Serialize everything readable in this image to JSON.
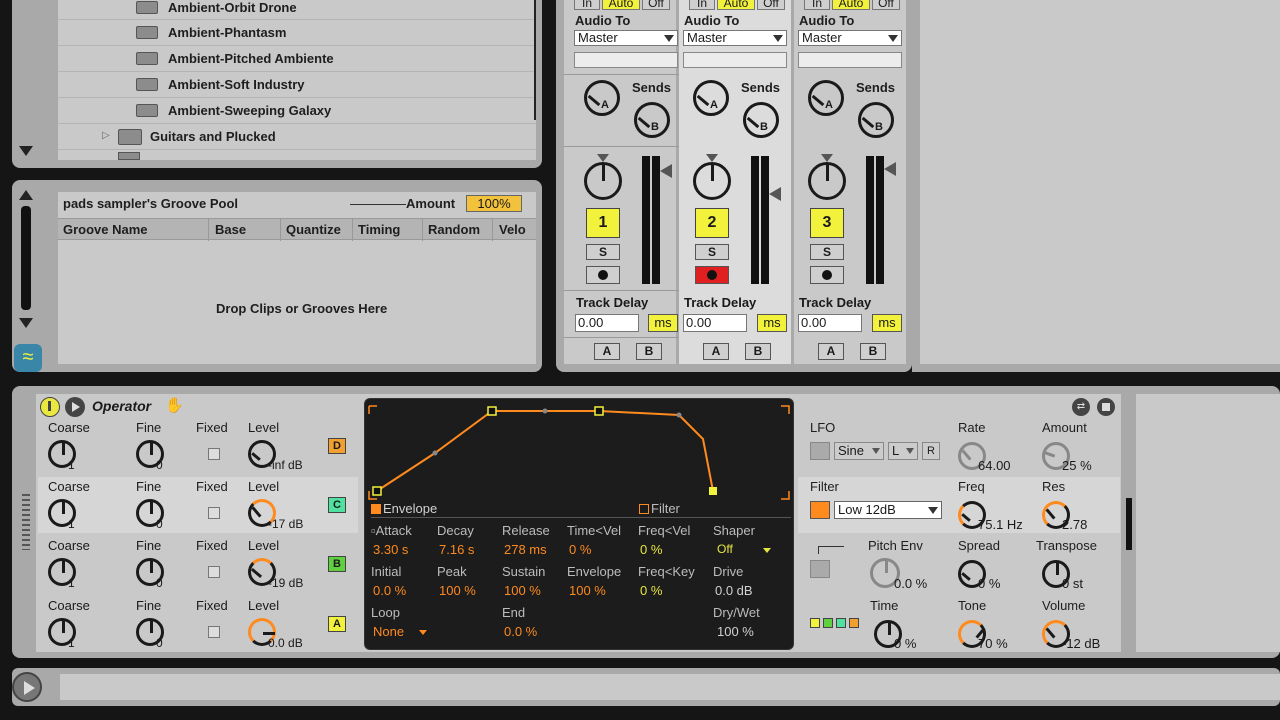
{
  "browser": {
    "items": [
      {
        "label": "Ambient-Orbit Drone"
      },
      {
        "label": "Ambient-Phantasm"
      },
      {
        "label": "Ambient-Pitched Ambiente"
      },
      {
        "label": "Ambient-Soft Industry"
      },
      {
        "label": "Ambient-Sweeping Galaxy"
      }
    ],
    "folder": "Guitars and Plucked"
  },
  "groove_pool": {
    "title": "pads sampler's Groove Pool",
    "amount_label": "Amount",
    "amount_value": "100%",
    "columns": [
      "Groove Name",
      "Base",
      "Quantize",
      "Timing",
      "Random",
      "Velo"
    ],
    "drop_text": "Drop Clips or Grooves Here"
  },
  "mixer": {
    "in_label": "In",
    "auto_label": "Auto",
    "off_label": "Off",
    "audio_to_label": "Audio To",
    "sends_label": "Sends",
    "send_a": "A",
    "send_b": "B",
    "solo_label": "S",
    "track_delay_label": "Track Delay",
    "ms_label": "ms",
    "xfade_a": "A",
    "xfade_b": "B",
    "tracks": [
      {
        "number": "1",
        "output": "Master",
        "delay": "0.00",
        "armed": false
      },
      {
        "number": "2",
        "output": "Master",
        "delay": "0.00",
        "armed": true
      },
      {
        "number": "3",
        "output": "Master",
        "delay": "0.00",
        "armed": false
      }
    ]
  },
  "operator": {
    "title": "Operator",
    "osc_labels": {
      "coarse": "Coarse",
      "fine": "Fine",
      "fixed": "Fixed",
      "level": "Level"
    },
    "oscillators": [
      {
        "coarse": "1",
        "fine": "0",
        "level": "-inf dB",
        "letter": "D",
        "color": "#f0a030"
      },
      {
        "coarse": "1",
        "fine": "0",
        "level": "-17 dB",
        "letter": "C",
        "color": "#50e0a0"
      },
      {
        "coarse": "1",
        "fine": "0",
        "level": "-19 dB",
        "letter": "B",
        "color": "#60d040"
      },
      {
        "coarse": "1",
        "fine": "0",
        "level": "0.0 dB",
        "letter": "A",
        "color": "#f2f23c"
      }
    ],
    "envelope": {
      "envelope_tab": "Envelope",
      "filter_tab": "Filter",
      "params": [
        {
          "label": "Attack",
          "value": "3.30 s"
        },
        {
          "label": "Decay",
          "value": "7.16 s"
        },
        {
          "label": "Release",
          "value": "278 ms"
        },
        {
          "label": "Time<Vel",
          "value": "0 %"
        },
        {
          "label": "Freq<Vel",
          "value": "0 %"
        },
        {
          "label": "Shaper",
          "value": "Off"
        },
        {
          "label": "Initial",
          "value": "0.0 %"
        },
        {
          "label": "Peak",
          "value": "100 %"
        },
        {
          "label": "Sustain",
          "value": "100 %"
        },
        {
          "label": "Envelope",
          "value": "100 %"
        },
        {
          "label": "Freq<Key",
          "value": "0 %"
        },
        {
          "label": "Drive",
          "value": "0.0 dB"
        },
        {
          "label": "Loop",
          "value": "None"
        },
        {
          "label": "End",
          "value": "0.0 %"
        },
        {
          "label": "Dry/Wet",
          "value": "100 %"
        }
      ]
    },
    "lfo": {
      "label": "LFO",
      "wave": "Sine",
      "sync": "L",
      "retrig": "R",
      "rate_label": "Rate",
      "rate": "64.00",
      "amount_label": "Amount",
      "amount": "25 %"
    },
    "filter": {
      "label": "Filter",
      "type": "Low 12dB",
      "freq_label": "Freq",
      "freq": "75.1 Hz",
      "res_label": "Res",
      "res": "2.78"
    },
    "pitch": {
      "pitch_env_label": "Pitch Env",
      "pitch_env": "0.0 %",
      "spread_label": "Spread",
      "spread": "0 %",
      "transpose_label": "Transpose",
      "transpose": "0 st"
    },
    "global": {
      "time_label": "Time",
      "time": "0 %",
      "tone_label": "Tone",
      "tone": "70 %",
      "volume_label": "Volume",
      "volume": "-12 dB"
    }
  },
  "colors": {
    "accent_yellow": "#f2f23c",
    "accent_orange": "#ff8a1e",
    "panel": "#c9c9c9",
    "frame": "#a9a9a9"
  }
}
